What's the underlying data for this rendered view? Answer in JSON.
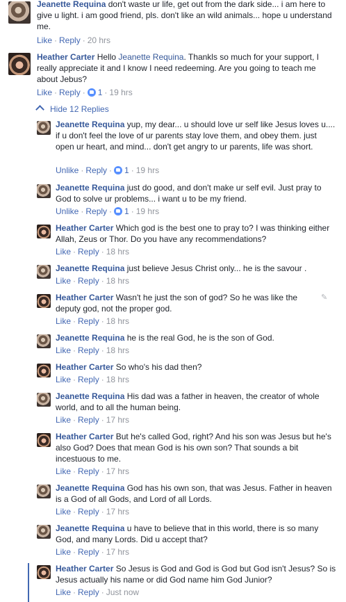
{
  "labels": {
    "like": "Like",
    "unlike": "Unlike",
    "reply": "Reply",
    "sep": "·"
  },
  "hide_replies_label": "Hide 12 Replies",
  "comments": [
    {
      "author": "Jeanette Requina",
      "text": "don't waste ur life, get out from the dark side... i am here to give u light. i am good friend, pls. don't like an wild animals... hope u understand me.",
      "action": "Like",
      "likes": "",
      "time": "20 hrs",
      "avatar": "jeanette"
    },
    {
      "author": "Heather Carter",
      "pre": "Hello ",
      "mention": "Jeanette Requina",
      "text": ". Thankls so much for your support, I really appreciate it and I know I need redeeming. Are you going to teach me about Jebus?",
      "action": "Like",
      "likes": "1",
      "time": "19 hrs",
      "avatar": "heather"
    },
    {
      "author": "Jeanette Requina",
      "text": "yup, my dear... u should love ur self like Jesus loves u.... if u don't feel the love of ur parents stay love them, and obey them. just open ur heart, and mind... don't get angry to ur parents, life was short.",
      "action": "Unlike",
      "likes": "1",
      "time": "19 hrs",
      "avatar": "jeanette"
    },
    {
      "author": "Jeanette Requina",
      "text": "just do good, and don't make ur self evil. Just pray to God to solve ur problems... i want u to be my friend.",
      "action": "Unlike",
      "likes": "1",
      "time": "19 hrs",
      "avatar": "jeanette"
    },
    {
      "author": "Heather Carter",
      "text": "Which god is the best one to pray to? I was thinking either Allah, Zeus or Thor. Do you have any recommendations?",
      "action": "Like",
      "likes": "",
      "time": "18 hrs",
      "avatar": "heather"
    },
    {
      "author": "Jeanette Requina",
      "text": "just believe Jesus Christ only... he is the savour .",
      "action": "Like",
      "likes": "",
      "time": "18 hrs",
      "avatar": "jeanette"
    },
    {
      "author": "Heather Carter",
      "text": "Wasn't he just the son of god? So he was like the deputy god, not the proper god.",
      "action": "Like",
      "likes": "",
      "time": "18 hrs",
      "avatar": "heather"
    },
    {
      "author": "Jeanette Requina",
      "text": "he is the real God, he is the son of God.",
      "action": "Like",
      "likes": "",
      "time": "18 hrs",
      "avatar": "jeanette"
    },
    {
      "author": "Heather Carter",
      "text": "So who's his dad then?",
      "action": "Like",
      "likes": "",
      "time": "18 hrs",
      "avatar": "heather"
    },
    {
      "author": "Jeanette Requina",
      "text": "His dad was a father in heaven, the creator of whole world, and to all the human being.",
      "action": "Like",
      "likes": "",
      "time": "17 hrs",
      "avatar": "jeanette"
    },
    {
      "author": "Heather Carter",
      "text": "But he's called God, right? And his son was Jesus but he's also God? Does that mean God is his own son? That sounds a bit incestuous to me.",
      "action": "Like",
      "likes": "",
      "time": "17 hrs",
      "avatar": "heather"
    },
    {
      "author": "Jeanette Requina",
      "text": "God has his own son, that was Jesus. Father in heaven is a God of all Gods, and Lord of all Lords.",
      "action": "Like",
      "likes": "",
      "time": "17 hrs",
      "avatar": "jeanette"
    },
    {
      "author": "Jeanette Requina",
      "text": "u have to believe that in this world, there is so many God, and many Lords. Did u accept that?",
      "action": "Like",
      "likes": "",
      "time": "17 hrs",
      "avatar": "jeanette"
    },
    {
      "author": "Heather Carter",
      "text": "So Jesus is God and God is God but God isn't Jesus? So is Jesus actually his name or did God name him God Junior?",
      "action": "Like",
      "likes": "",
      "time": "Just now",
      "avatar": "heather"
    }
  ]
}
